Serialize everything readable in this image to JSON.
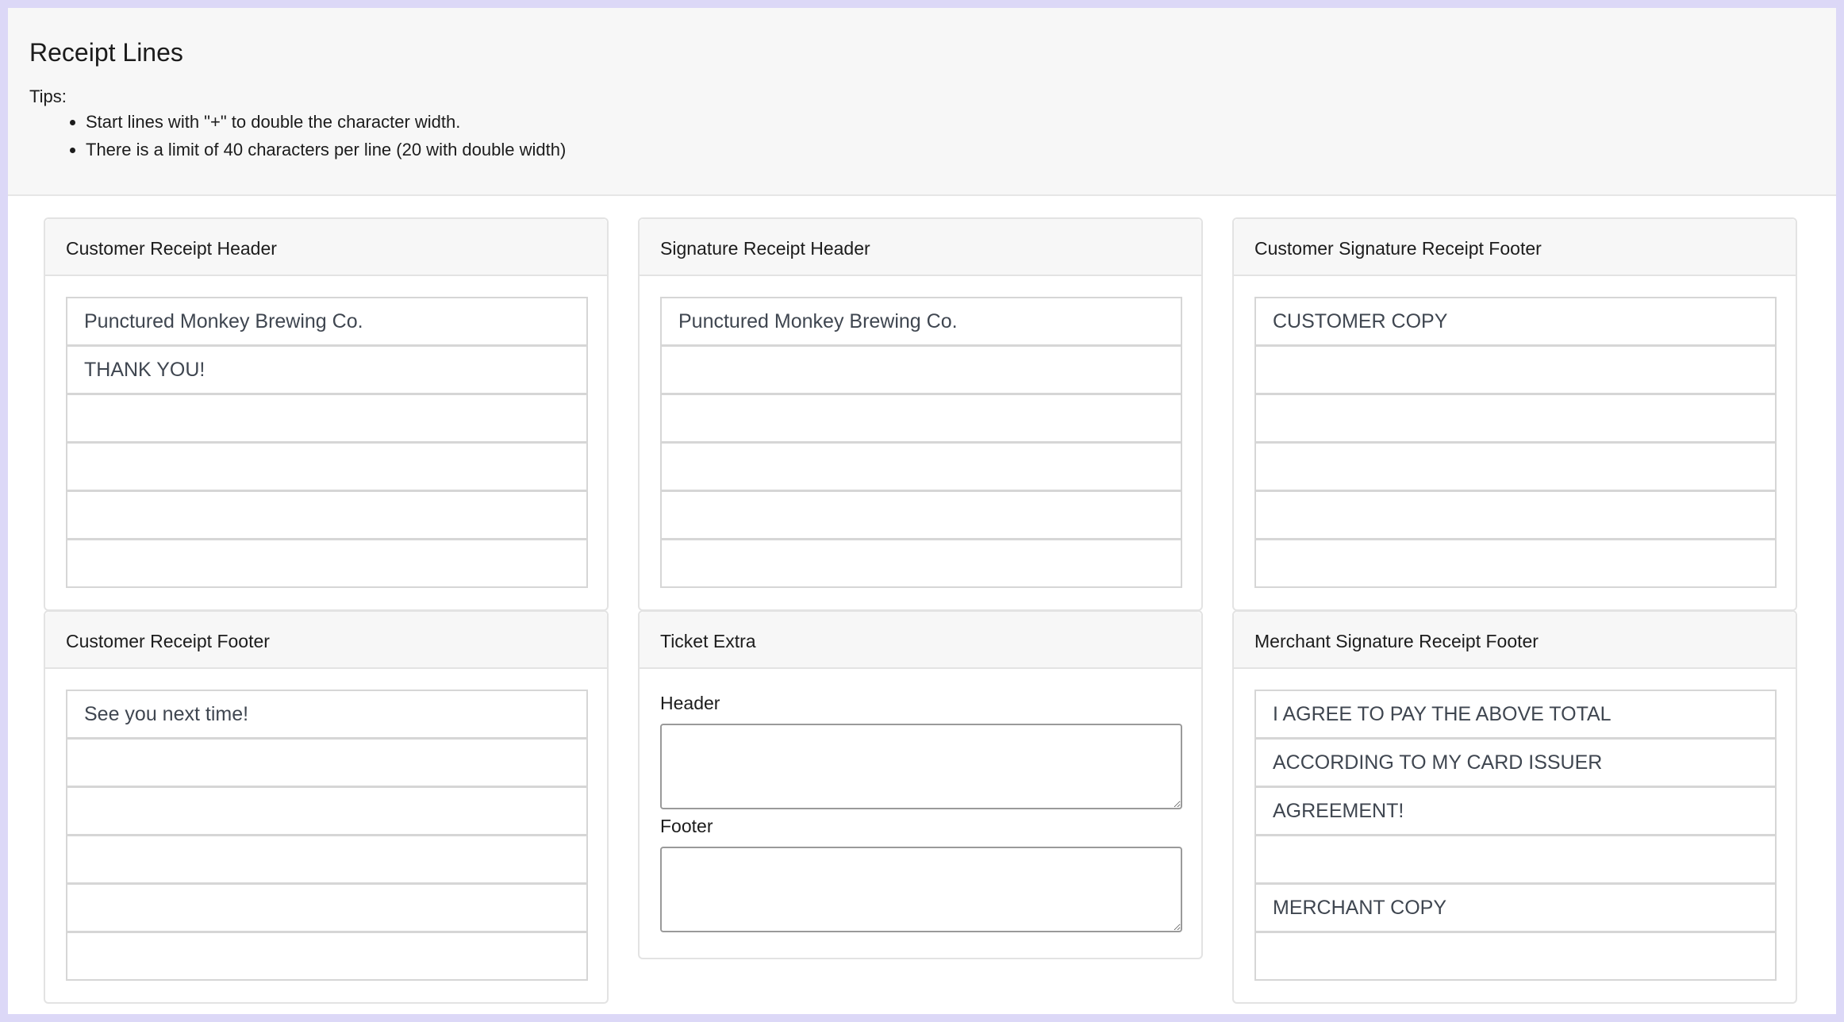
{
  "page": {
    "title": "Receipt Lines",
    "tips_label": "Tips:",
    "tips": [
      "Start lines with \"+\" to double the character width.",
      "There is a limit of 40 characters per line (20 with double width)"
    ]
  },
  "panels": {
    "customer_receipt_header": {
      "title": "Customer Receipt Header",
      "lines": [
        "Punctured Monkey Brewing Co.",
        "THANK YOU!",
        "",
        "",
        "",
        ""
      ]
    },
    "signature_receipt_header": {
      "title": "Signature Receipt Header",
      "lines": [
        "Punctured Monkey Brewing Co.",
        "",
        "",
        "",
        "",
        ""
      ]
    },
    "customer_signature_receipt_footer": {
      "title": "Customer Signature Receipt Footer",
      "lines": [
        "CUSTOMER COPY",
        "",
        "",
        "",
        "",
        ""
      ]
    },
    "customer_receipt_footer": {
      "title": "Customer Receipt Footer",
      "lines": [
        "See you next time!",
        "",
        "",
        "",
        "",
        ""
      ]
    },
    "ticket_extra": {
      "title": "Ticket Extra",
      "header_label": "Header",
      "header_value": "",
      "footer_label": "Footer",
      "footer_value": ""
    },
    "merchant_signature_receipt_footer": {
      "title": "Merchant Signature Receipt Footer",
      "lines": [
        "I AGREE TO PAY THE ABOVE TOTAL",
        "ACCORDING TO MY CARD ISSUER",
        "AGREEMENT!",
        "",
        "MERCHANT COPY",
        ""
      ]
    }
  }
}
